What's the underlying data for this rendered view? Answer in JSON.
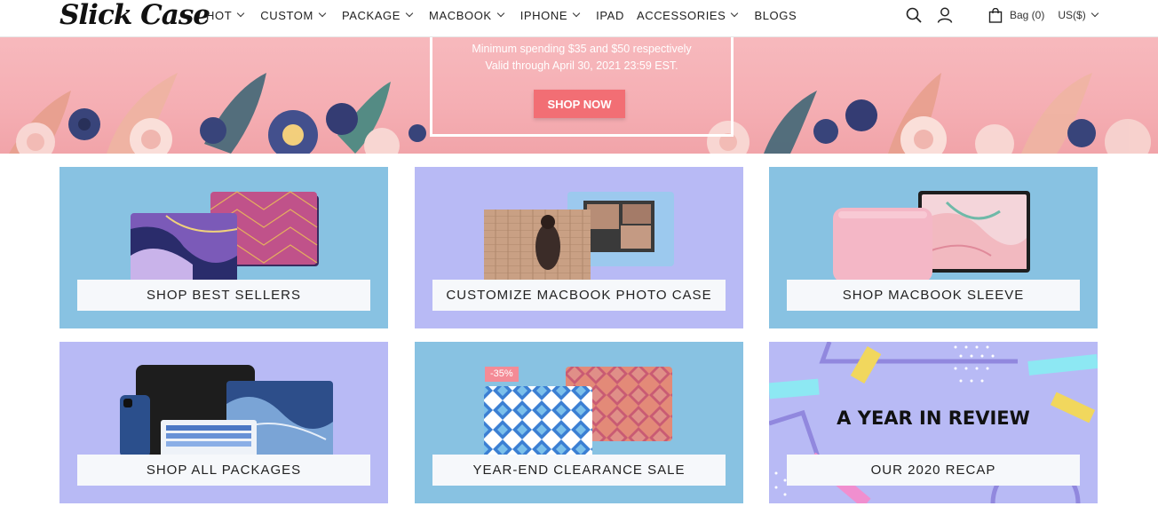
{
  "brand": {
    "logo_text": "Slick Case"
  },
  "nav": {
    "items": [
      {
        "label": "HOT",
        "has_dropdown": true
      },
      {
        "label": "CUSTOM",
        "has_dropdown": true
      },
      {
        "label": "PACKAGE",
        "has_dropdown": true
      },
      {
        "label": "MACBOOK",
        "has_dropdown": true
      },
      {
        "label": "IPHONE",
        "has_dropdown": true
      },
      {
        "label": "IPAD",
        "has_dropdown": false
      },
      {
        "label": "ACCESSORIES",
        "has_dropdown": true
      },
      {
        "label": "BLOGS",
        "has_dropdown": false
      }
    ]
  },
  "header_actions": {
    "search_icon": "search-icon",
    "account_icon": "user-icon",
    "bag_label": "Bag (0)",
    "currency_label": "US($)"
  },
  "banner": {
    "line1": "Minimum spending $35 and $50 respectively",
    "line2": "Valid through April 30, 2021 23:59 EST.",
    "cta": "SHOP NOW"
  },
  "tiles": [
    {
      "label": "SHOP BEST SELLERS"
    },
    {
      "label": "CUSTOMIZE MACBOOK PHOTO CASE"
    },
    {
      "label": "SHOP MACBOOK SLEEVE"
    },
    {
      "label": "SHOP ALL PACKAGES"
    },
    {
      "label": "YEAR-END CLEARANCE SALE",
      "badge": "-35%"
    },
    {
      "label": "OUR 2020 RECAP",
      "headline": "A YEAR IN REVIEW"
    }
  ],
  "colors": {
    "tile_blue": "#88c2e2",
    "tile_purple": "#b8baf5",
    "banner_pink": "#f5aeb3",
    "cta_red": "#f26e74"
  }
}
